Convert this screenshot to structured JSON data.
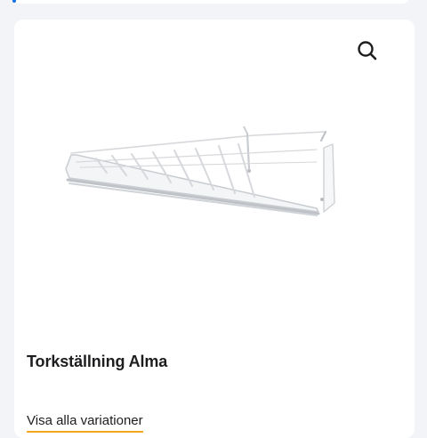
{
  "product": {
    "title": "Torkställning Alma",
    "variants_link": "Visa alla variationer",
    "image_icon": "drying-rack-image"
  },
  "actions": {
    "zoom_icon": "search-icon"
  },
  "colors": {
    "background": "#f3f4f8",
    "card": "#ffffff",
    "link_underline": "#f5a623",
    "accent": "#1a73e8",
    "text": "#1d1d1f"
  }
}
